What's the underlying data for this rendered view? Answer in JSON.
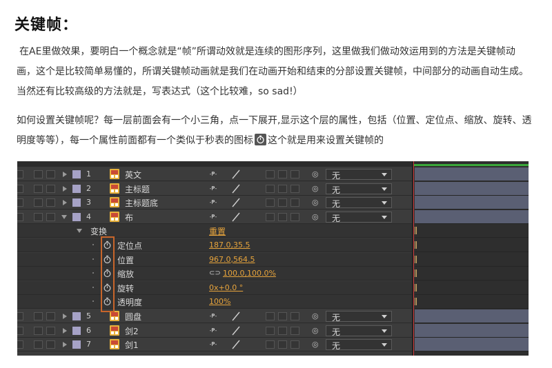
{
  "heading": "关键帧：",
  "paragraph1": "在AE里做效果，要明白一个概念就是“帧”所谓动效就是连续的图形序列，这里做我们做动效运用到的方法是关键帧动画，这个是比较简单易懂的，所谓关键帧动画就是我们在动画开始和结束的分部设置关键帧，中间部分的动画自动生成。当然还有比较高级的方法就是，写表达式（这个比较难，so sad!）",
  "paragraph2_before": "如何设置关键帧呢？每一层前面会有一个小三角，点一下展开,显示这个层的属性，包括（位置、定位点、缩放、旋转、透明度等等），每一个属性前面都有一个类似于秒表的图标",
  "paragraph2_after": "这个就是用来设置关键帧的",
  "panel": {
    "dropdown_value": "无",
    "layers_top": [
      {
        "num": "1",
        "name": "英文"
      },
      {
        "num": "2",
        "name": "主标题"
      },
      {
        "num": "3",
        "name": "主标题底"
      },
      {
        "num": "4",
        "name": "布"
      }
    ],
    "transform": {
      "name": "变换",
      "reset": "重置"
    },
    "properties": [
      {
        "name": "定位点",
        "value": "187.0,35.5"
      },
      {
        "name": "位置",
        "value": "967.0,564.5"
      },
      {
        "name": "缩放",
        "value": "100.0,100.0%"
      },
      {
        "name": "旋转",
        "value": "0x+0.0 °"
      },
      {
        "name": "透明度",
        "value": "100%"
      }
    ],
    "layers_bottom": [
      {
        "num": "5",
        "name": "圆盘"
      },
      {
        "num": "6",
        "name": "剑2"
      },
      {
        "num": "7",
        "name": "剑1"
      }
    ]
  },
  "colors": {
    "accent_orange": "#e7a43c",
    "highlight": "#c8652a",
    "label_purple": "#a6a2c6",
    "timeline_bar": "#5a5f73"
  }
}
